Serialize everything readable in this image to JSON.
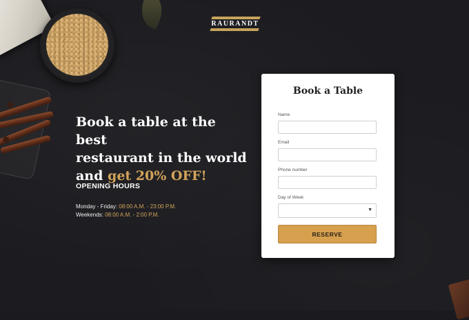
{
  "brand": {
    "logo_text": "RAURANDT"
  },
  "hero": {
    "title_line1": "Book a table at the best",
    "title_line2": "restaurant in the world",
    "title_line3_prefix": "and ",
    "title_line3_accent": "get 20% OFF!",
    "accent_color": "#d3a35a"
  },
  "opening_hours": {
    "heading": "OPENING HOURS",
    "rows": [
      {
        "label": "Monday - Friday: ",
        "time": "08:00 A.M. - 23:00 P.M."
      },
      {
        "label": "Weekends: ",
        "time": "08:00 A.M. - 2:00 P.M."
      }
    ]
  },
  "form": {
    "title": "Book a Table",
    "fields": {
      "name": {
        "label": "Name",
        "value": ""
      },
      "email": {
        "label": "Email",
        "value": ""
      },
      "phone": {
        "label": "Phone number",
        "value": ""
      },
      "day": {
        "label": "Day of Week",
        "value": ""
      }
    },
    "submit_label": "RESERVE",
    "button_color": "#d6a04f"
  },
  "icons": {
    "select_caret": "caret-down-icon"
  }
}
